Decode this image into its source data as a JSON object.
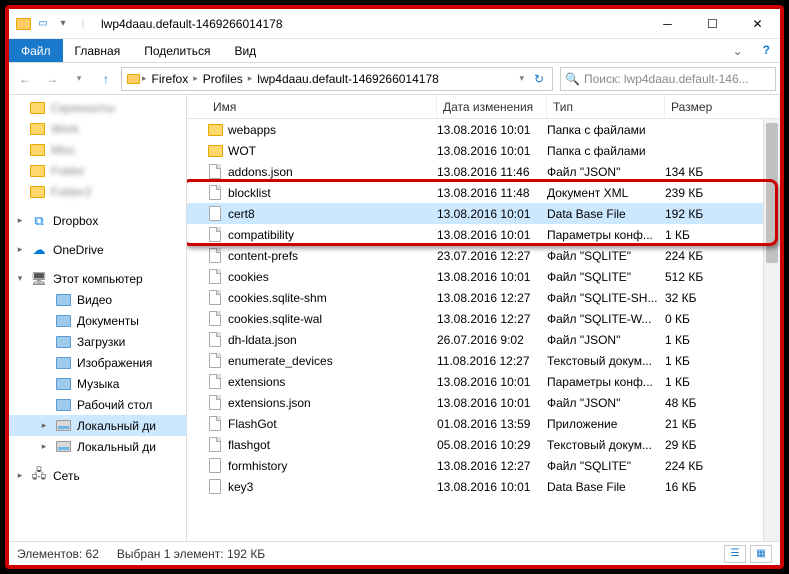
{
  "window": {
    "title": "lwp4daau.default-1469266014178"
  },
  "ribbon": {
    "file": "Файл",
    "home": "Главная",
    "share": "Поделиться",
    "view": "Вид"
  },
  "breadcrumb": {
    "items": [
      "Firefox",
      "Profiles",
      "lwp4daau.default-1469266014178"
    ]
  },
  "search": {
    "placeholder": "Поиск: lwp4daau.default-146..."
  },
  "sidebar": {
    "quick": [
      {
        "label": "Скриншоты",
        "blur": true
      },
      {
        "label": "Work",
        "blur": true
      },
      {
        "label": "Misc",
        "blur": true
      },
      {
        "label": "Folder",
        "blur": true
      },
      {
        "label": "Folder2",
        "blur": true
      }
    ],
    "dropbox": "Dropbox",
    "onedrive": "OneDrive",
    "thispc": "Этот компьютер",
    "pc_items": [
      {
        "label": "Видео"
      },
      {
        "label": "Документы"
      },
      {
        "label": "Загрузки"
      },
      {
        "label": "Изображения"
      },
      {
        "label": "Музыка"
      },
      {
        "label": "Рабочий стол"
      },
      {
        "label": "Локальный ди",
        "sel": true,
        "disk": true
      },
      {
        "label": "Локальный ди",
        "disk": true
      }
    ],
    "network": "Сеть"
  },
  "columns": {
    "name": "Имя",
    "date": "Дата изменения",
    "type": "Тип",
    "size": "Размер"
  },
  "highlight": {
    "row_start": 3,
    "row_count": 3
  },
  "files": [
    {
      "icon": "folder",
      "name": "webapps",
      "date": "13.08.2016 10:01",
      "type": "Папка с файлами",
      "size": ""
    },
    {
      "icon": "folder",
      "name": "WOT",
      "date": "13.08.2016 10:01",
      "type": "Папка с файлами",
      "size": ""
    },
    {
      "icon": "file",
      "name": "addons.json",
      "date": "13.08.2016 11:46",
      "type": "Файл \"JSON\"",
      "size": "134 КБ"
    },
    {
      "icon": "file",
      "name": "blocklist",
      "date": "13.08.2016 11:48",
      "type": "Документ XML",
      "size": "239 КБ"
    },
    {
      "icon": "db",
      "name": "cert8",
      "date": "13.08.2016 10:01",
      "type": "Data Base File",
      "size": "192 КБ",
      "sel": true
    },
    {
      "icon": "file",
      "name": "compatibility",
      "date": "13.08.2016 10:01",
      "type": "Параметры конф...",
      "size": "1 КБ"
    },
    {
      "icon": "file",
      "name": "content-prefs",
      "date": "23.07.2016 12:27",
      "type": "Файл \"SQLITE\"",
      "size": "224 КБ"
    },
    {
      "icon": "file",
      "name": "cookies",
      "date": "13.08.2016 10:01",
      "type": "Файл \"SQLITE\"",
      "size": "512 КБ"
    },
    {
      "icon": "file",
      "name": "cookies.sqlite-shm",
      "date": "13.08.2016 12:27",
      "type": "Файл \"SQLITE-SH...",
      "size": "32 КБ"
    },
    {
      "icon": "file",
      "name": "cookies.sqlite-wal",
      "date": "13.08.2016 12:27",
      "type": "Файл \"SQLITE-W...",
      "size": "0 КБ"
    },
    {
      "icon": "file",
      "name": "dh-ldata.json",
      "date": "26.07.2016 9:02",
      "type": "Файл \"JSON\"",
      "size": "1 КБ"
    },
    {
      "icon": "file",
      "name": "enumerate_devices",
      "date": "11.08.2016 12:27",
      "type": "Текстовый докум...",
      "size": "1 КБ"
    },
    {
      "icon": "file",
      "name": "extensions",
      "date": "13.08.2016 10:01",
      "type": "Параметры конф...",
      "size": "1 КБ"
    },
    {
      "icon": "file",
      "name": "extensions.json",
      "date": "13.08.2016 10:01",
      "type": "Файл \"JSON\"",
      "size": "48 КБ"
    },
    {
      "icon": "file",
      "name": "FlashGot",
      "date": "01.08.2016 13:59",
      "type": "Приложение",
      "size": "21 КБ"
    },
    {
      "icon": "file",
      "name": "flashgot",
      "date": "05.08.2016 10:29",
      "type": "Текстовый докум...",
      "size": "29 КБ"
    },
    {
      "icon": "db",
      "name": "formhistory",
      "date": "13.08.2016 12:27",
      "type": "Файл \"SQLITE\"",
      "size": "224 КБ"
    },
    {
      "icon": "db",
      "name": "key3",
      "date": "13.08.2016 10:01",
      "type": "Data Base File",
      "size": "16 КБ"
    }
  ],
  "status": {
    "count_label": "Элементов: 62",
    "selection_label": "Выбран 1 элемент: 192 КБ"
  }
}
